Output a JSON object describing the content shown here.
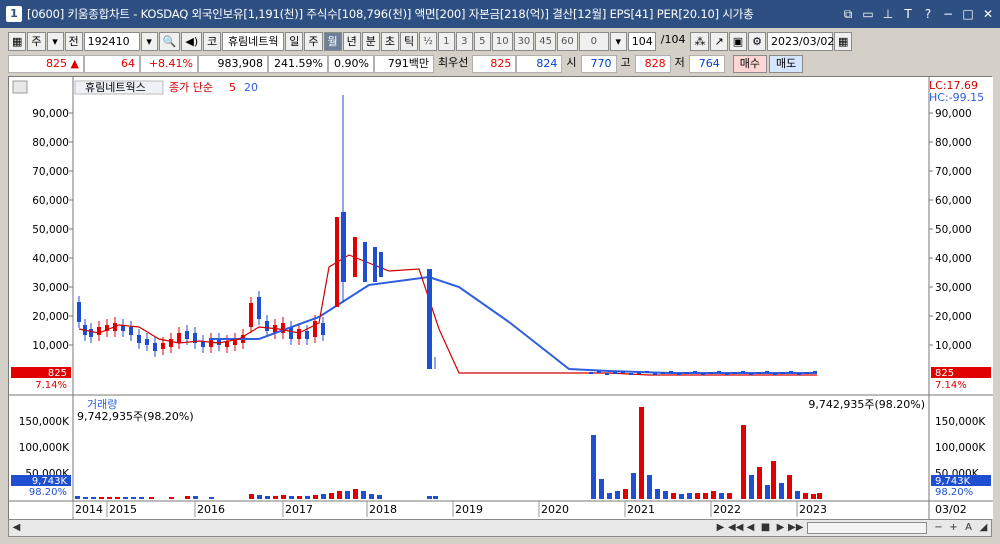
{
  "window": {
    "icon": "1",
    "title": "[0600] 키움종합차트 - KOSDAQ 외국인보유[1,191(천)] 주식수[108,796(천)] 액면[200] 자본금[218(억)] 결산[12월] EPS[41] PER[20.10] 시가총"
  },
  "toolbar": {
    "type_label": "주",
    "prev_label": "전",
    "code": "192410",
    "stock_button": "코",
    "stock_name": "휴림네트웍",
    "periods": [
      "일",
      "주",
      "월",
      "년",
      "분",
      "초",
      "틱"
    ],
    "active_period": "월",
    "fraction_label": "½",
    "intervals": [
      "1",
      "3",
      "5",
      "10",
      "30",
      "45",
      "60"
    ],
    "dropdown_value": "0",
    "count_value": "104",
    "count_total": "/104",
    "date": "2023/03/02"
  },
  "quote": {
    "price": "825 ▲",
    "change": "64",
    "change_pct": "+8.41%",
    "volume": "983,908",
    "volume_ratio": "241.59%",
    "turnover": "0.90%",
    "amount": "791백만",
    "best_label": "최우선",
    "best_ask": "825",
    "best_bid": "824",
    "open_label": "시",
    "open": "770",
    "high_label": "고",
    "high": "828",
    "low_label": "저",
    "low": "764",
    "buy_label": "매수",
    "sell_label": "매도"
  },
  "chart": {
    "legend_name": "휴림네트웍스",
    "legend_ma": "종가 단순",
    "legend_ma5": "5",
    "legend_ma20": "20",
    "lc_label": "LC:17.69",
    "hc_label": "HC:-99.15",
    "price_ticks": [
      "90,000",
      "80,000",
      "70,000",
      "60,000",
      "50,000",
      "40,000",
      "30,000",
      "20,000",
      "10,000"
    ],
    "current_badge": "825",
    "current_pct": "7.14%",
    "volume_title": "거래량",
    "volume_info": "9,742,935주(98.20%)",
    "volume_info_right": "9,742,935주(98.20%)",
    "volume_ticks": [
      "150,000K",
      "100,000K",
      "50,000K"
    ],
    "volume_badge": "9,743K",
    "volume_pct": "98.20%",
    "years": [
      "2014",
      "2015",
      "2016",
      "2017",
      "2018",
      "2019",
      "2020",
      "2021",
      "2022",
      "2023"
    ],
    "right_date": "03/02",
    "colors": {
      "up": "#e00000",
      "down": "#1f4fd0",
      "ma5": "#d00000",
      "ma20": "#2f5fe0"
    }
  },
  "chart_data": {
    "type": "candlestick",
    "ylim": [
      0,
      100000
    ],
    "candles_approx": [
      [
        2014.0,
        22000,
        17000,
        25000,
        14000
      ],
      [
        2014.2,
        17000,
        15000,
        18000,
        13000
      ],
      [
        2014.5,
        14000,
        13500,
        15000,
        12000
      ],
      [
        2015.0,
        15000,
        17000,
        18000,
        14000
      ],
      [
        2015.5,
        16000,
        14000,
        17000,
        12000
      ],
      [
        2015.8,
        12000,
        10000,
        13000,
        8000
      ],
      [
        2016.0,
        10000,
        13000,
        16000,
        9000
      ],
      [
        2016.5,
        12000,
        10000,
        12000,
        8000
      ],
      [
        2016.8,
        10000,
        11000,
        14000,
        9000
      ],
      [
        2017.0,
        12000,
        20000,
        28000,
        11000
      ],
      [
        2017.3,
        20000,
        18000,
        22000,
        15000
      ],
      [
        2017.5,
        16000,
        14000,
        20000,
        13000
      ],
      [
        2017.8,
        14000,
        40000,
        45000,
        13000
      ],
      [
        2018.0,
        42000,
        56000,
        97000,
        30000
      ],
      [
        2018.3,
        50000,
        38000,
        56000,
        30000
      ],
      [
        2018.6,
        40000,
        36000,
        50000,
        32000
      ],
      [
        2018.8,
        37000,
        1500,
        37000,
        1000
      ],
      [
        2019.0,
        6000,
        1200,
        7000,
        1000
      ],
      [
        2023.2,
        770,
        825,
        828,
        764
      ]
    ],
    "volume_peaks_k": [
      [
        2020.6,
        120000
      ],
      [
        2021.2,
        170000
      ],
      [
        2022.4,
        140000
      ],
      [
        2022.7,
        75000
      ]
    ]
  }
}
